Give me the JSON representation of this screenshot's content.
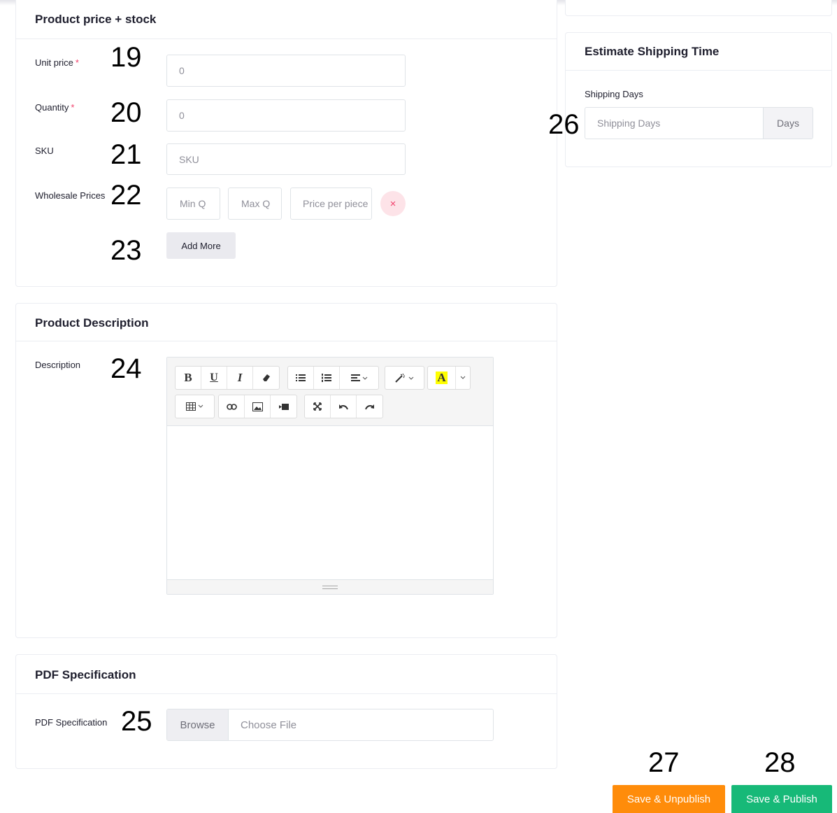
{
  "price_stock": {
    "title": "Product price + stock",
    "unit_price": {
      "label": "Unit price",
      "required": "*",
      "value": "0",
      "annotation": "19"
    },
    "quantity": {
      "label": "Quantity",
      "required": "*",
      "value": "0",
      "annotation": "20"
    },
    "sku": {
      "label": "SKU",
      "placeholder": "SKU",
      "annotation": "21"
    },
    "wholesale": {
      "label": "Wholesale Prices",
      "annotation": "22",
      "min_placeholder": "Min Q",
      "max_placeholder": "Max Q",
      "price_placeholder": "Price per piece",
      "remove_symbol": "×"
    },
    "add_more": {
      "label": "Add More",
      "annotation": "23"
    }
  },
  "description": {
    "title": "Product Description",
    "label": "Description",
    "annotation": "24",
    "toolbar_icons": {
      "bold": "B",
      "underline": "U",
      "italic": "I",
      "eraser": "eraser-icon",
      "unordered_list": "ul-icon",
      "ordered_list": "ol-icon",
      "align": "align-icon",
      "style": "magic-wand-icon",
      "color": "A",
      "table": "table-icon",
      "link": "link-icon",
      "picture": "picture-icon",
      "video": "video-icon",
      "fullscreen": "fullscreen-icon",
      "undo": "undo-icon",
      "redo": "redo-icon"
    },
    "highlight_color": "#ffff00"
  },
  "pdf": {
    "title": "PDF Specification",
    "label": "PDF Specification",
    "annotation": "25",
    "browse_label": "Browse",
    "file_placeholder": "Choose File"
  },
  "shipping": {
    "title": "Estimate Shipping Time",
    "label": "Shipping Days",
    "placeholder": "Shipping Days",
    "suffix": "Days",
    "annotation": "26"
  },
  "actions": {
    "unpublish": {
      "label": "Save & Unpublish",
      "annotation": "27",
      "color": "#ff8c0a"
    },
    "publish": {
      "label": "Save & Publish",
      "annotation": "28",
      "color": "#17b978"
    }
  }
}
